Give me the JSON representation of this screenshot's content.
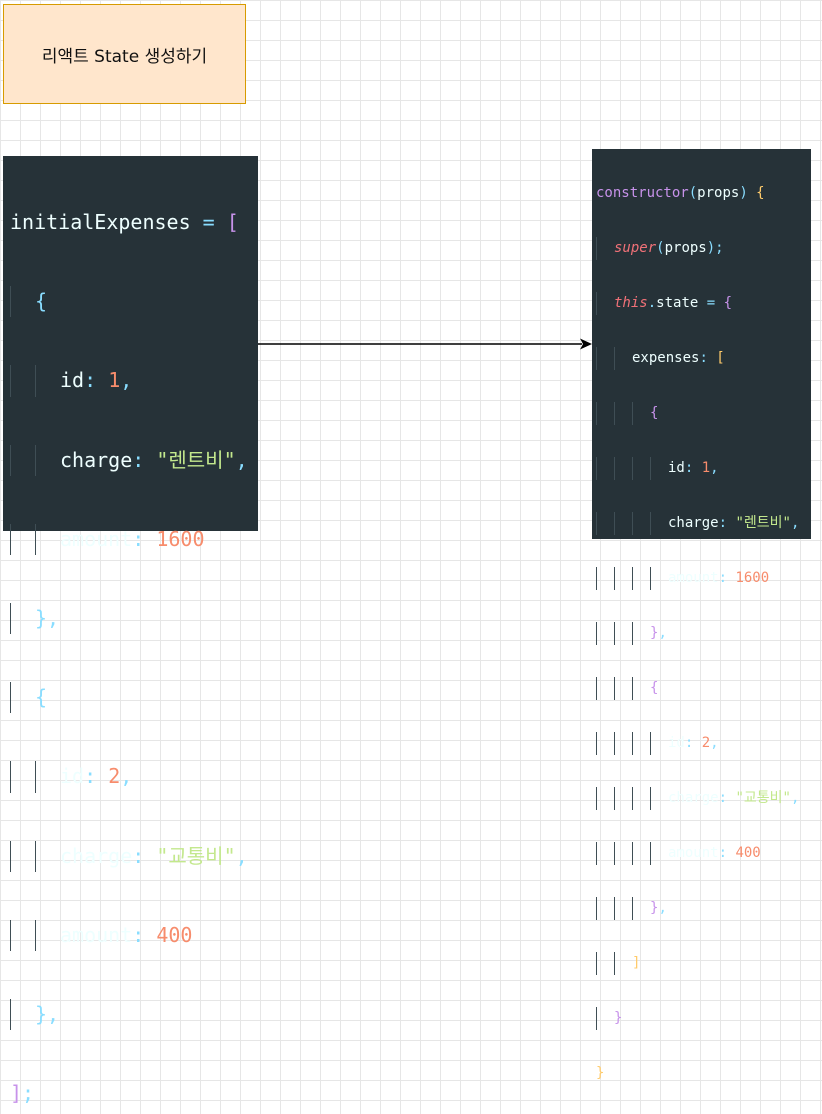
{
  "title_note": "리액트 State 생성하기",
  "left_code": {
    "var": "initialExpenses",
    "eq": " = ",
    "open": "[",
    "close_end": "];",
    "items": [
      {
        "id_key": "id",
        "id_val": "1",
        "charge_key": "charge",
        "charge_val": "\"렌트비\"",
        "amount_key": "amount",
        "amount_val": "1600"
      },
      {
        "id_key": "id",
        "id_val": "2",
        "charge_key": "charge",
        "charge_val": "\"교통비\"",
        "amount_key": "amount",
        "amount_val": "400"
      }
    ]
  },
  "right_code": {
    "ctor": "constructor",
    "param": "props",
    "super_kw": "super",
    "this_kw": "this",
    "state_prop": "state",
    "expenses_key": "expenses",
    "items": [
      {
        "id_key": "id",
        "id_val": "1",
        "charge_key": "charge",
        "charge_val": "\"렌트비\"",
        "amount_key": "amount",
        "amount_val": "1600"
      },
      {
        "id_key": "id",
        "id_val": "2",
        "charge_key": "charge",
        "charge_val": "\"교통비\"",
        "amount_key": "amount",
        "amount_val": "400"
      }
    ]
  },
  "colors": {
    "note_fill": "#ffe6cc",
    "note_border": "#d79b00",
    "code_bg": "#263238",
    "string": "#c3e88d",
    "number": "#f78c6c",
    "keyword": "#c792ea",
    "punct": "#89ddff"
  }
}
